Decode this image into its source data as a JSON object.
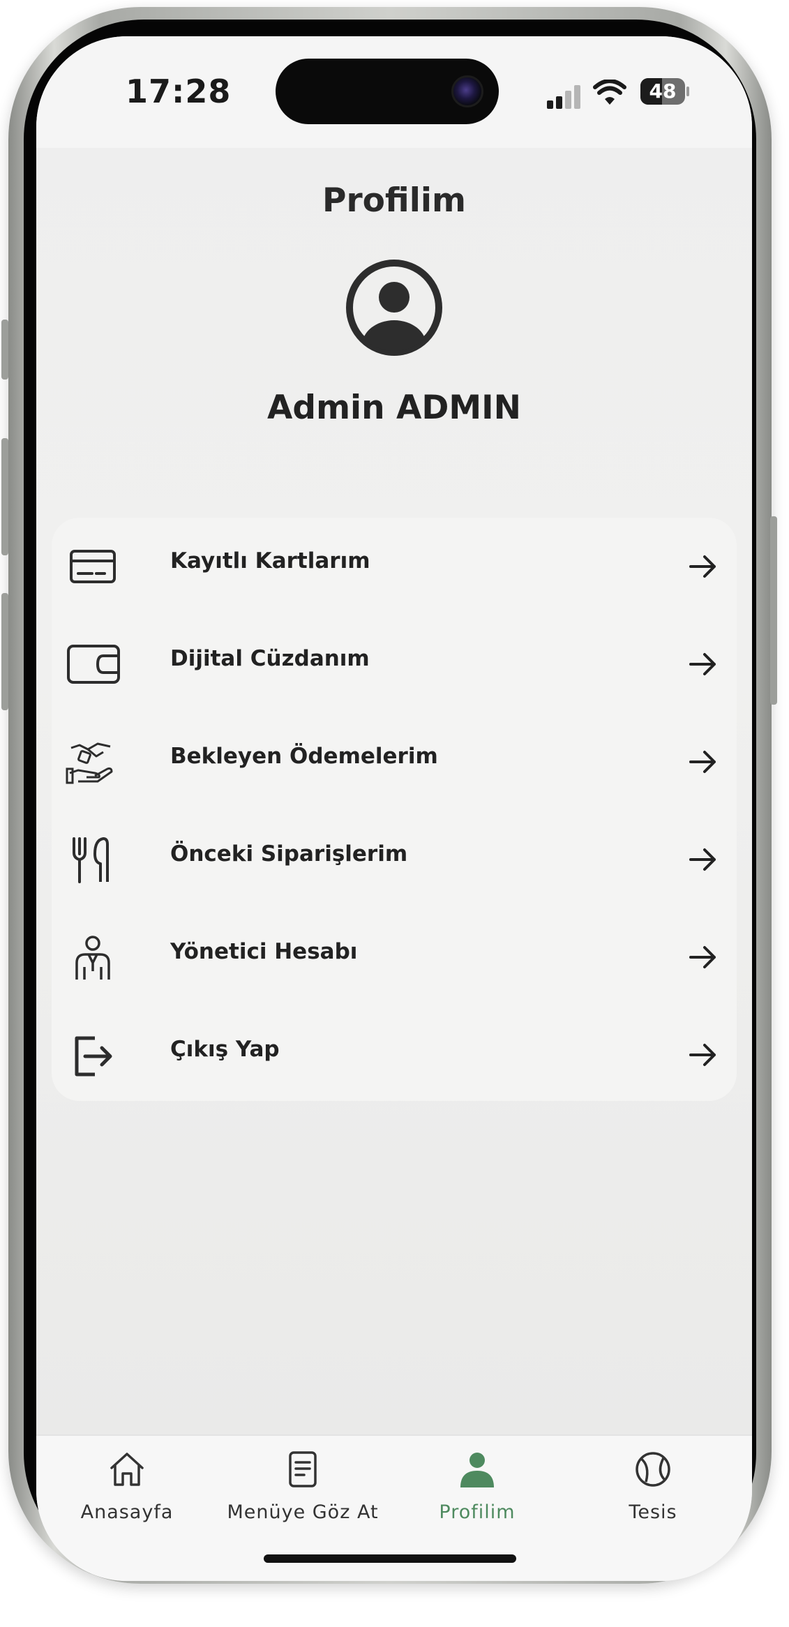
{
  "status_bar": {
    "time": "17:28",
    "battery": "48",
    "signal_icon": "cellular-signal-icon",
    "wifi_icon": "wifi-icon"
  },
  "page": {
    "title": "Profilim"
  },
  "profile": {
    "avatar_icon": "user-circle-icon",
    "name": "Admin ADMIN"
  },
  "menu": {
    "items": [
      {
        "label": "Kayıtlı Kartlarım",
        "icon": "credit-card-icon"
      },
      {
        "label": "Dijital Cüzdanım",
        "icon": "wallet-icon"
      },
      {
        "label": "Bekleyen Ödemelerim",
        "icon": "handshake-payment-icon"
      },
      {
        "label": "Önceki Siparişlerim",
        "icon": "fork-knife-icon"
      },
      {
        "label": "Yönetici Hesabı",
        "icon": "manager-user-icon"
      },
      {
        "label": "Çıkış Yap",
        "icon": "logout-icon"
      }
    ],
    "arrow_icon": "arrow-right-icon"
  },
  "bottom_nav": {
    "items": [
      {
        "label": "Anasayfa",
        "icon": "home-icon",
        "active": false
      },
      {
        "label": "Menüye Göz At",
        "icon": "menu-document-icon",
        "active": false
      },
      {
        "label": "Profilim",
        "icon": "user-icon",
        "active": true
      },
      {
        "label": "Tesis",
        "icon": "tennis-ball-icon",
        "active": false
      }
    ]
  },
  "colors": {
    "accent": "#4e8a5f",
    "text": "#222222",
    "background": "#eeeeee"
  }
}
